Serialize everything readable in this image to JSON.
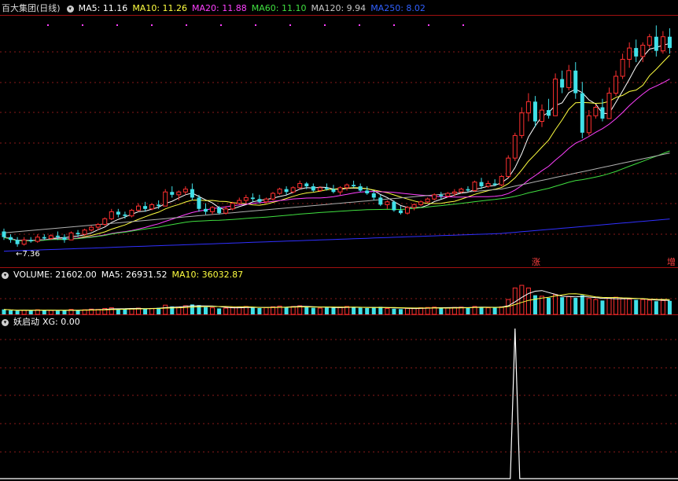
{
  "price_header": {
    "title": "百大集团(日线)",
    "ma5": "MA5: 11.16",
    "ma10": "MA10: 11.26",
    "ma20": "MA20: 11.88",
    "ma60": "MA60: 11.10",
    "ma120": "MA120: 9.94",
    "ma250": "MA250: 8.02"
  },
  "volume_header": {
    "volume": "VOLUME: 21602.00",
    "ma5": "MA5: 26931.52",
    "ma10": "MA10: 36032.87"
  },
  "indicator_header": {
    "name": "妖启动",
    "xg": "XG: 0.00"
  },
  "annotations": {
    "low_price": "7.36",
    "zhang_marker": "涨",
    "zeng_marker": "增"
  },
  "colors": {
    "up": "#ff3030",
    "down": "#40e0e8",
    "ma5": "#ffffff",
    "ma10": "#ffff40",
    "ma20": "#ff40ff",
    "ma60": "#40e040",
    "ma120": "#b0b0b0",
    "ma250": "#3030ff",
    "grid": "#8a1a1a"
  },
  "chart_data": [
    {
      "type": "candlestick",
      "title": "百大集团(日线)",
      "ylim": [
        6.8,
        15.6
      ],
      "low_label": 7.36,
      "ohlc": [
        [
          7.9,
          8.0,
          7.6,
          7.7
        ],
        [
          7.7,
          7.8,
          7.5,
          7.6
        ],
        [
          7.6,
          7.7,
          7.36,
          7.45
        ],
        [
          7.45,
          7.7,
          7.4,
          7.6
        ],
        [
          7.6,
          7.7,
          7.5,
          7.55
        ],
        [
          7.55,
          7.8,
          7.5,
          7.7
        ],
        [
          7.7,
          7.8,
          7.6,
          7.65
        ],
        [
          7.65,
          7.8,
          7.6,
          7.75
        ],
        [
          7.75,
          7.9,
          7.6,
          7.7
        ],
        [
          7.7,
          7.8,
          7.5,
          7.6
        ],
        [
          7.6,
          7.9,
          7.6,
          7.85
        ],
        [
          7.85,
          7.95,
          7.7,
          7.8
        ],
        [
          7.8,
          8.0,
          7.75,
          7.95
        ],
        [
          7.95,
          8.1,
          7.9,
          8.05
        ],
        [
          8.05,
          8.2,
          7.95,
          8.15
        ],
        [
          8.15,
          8.4,
          8.1,
          8.35
        ],
        [
          8.35,
          8.7,
          8.3,
          8.6
        ],
        [
          8.6,
          8.7,
          8.4,
          8.5
        ],
        [
          8.5,
          8.6,
          8.35,
          8.45
        ],
        [
          8.45,
          8.7,
          8.4,
          8.65
        ],
        [
          8.65,
          8.9,
          8.6,
          8.8
        ],
        [
          8.8,
          8.95,
          8.6,
          8.7
        ],
        [
          8.7,
          8.9,
          8.65,
          8.85
        ],
        [
          8.85,
          9.0,
          8.7,
          8.8
        ],
        [
          8.8,
          9.4,
          8.8,
          9.3
        ],
        [
          9.3,
          9.5,
          9.1,
          9.2
        ],
        [
          9.2,
          9.35,
          9.0,
          9.3
        ],
        [
          9.3,
          9.5,
          9.2,
          9.4
        ],
        [
          9.4,
          9.6,
          9.0,
          9.1
        ],
        [
          9.1,
          9.2,
          8.6,
          8.7
        ],
        [
          8.7,
          8.9,
          8.5,
          8.6
        ],
        [
          8.6,
          8.8,
          8.5,
          8.75
        ],
        [
          8.75,
          8.8,
          8.5,
          8.55
        ],
        [
          8.55,
          8.8,
          8.5,
          8.7
        ],
        [
          8.7,
          8.95,
          8.65,
          8.9
        ],
        [
          8.9,
          9.1,
          8.85,
          9.0
        ],
        [
          9.0,
          9.2,
          8.9,
          9.1
        ],
        [
          9.1,
          9.25,
          8.95,
          9.05
        ],
        [
          9.05,
          9.2,
          8.9,
          8.95
        ],
        [
          8.95,
          9.1,
          8.9,
          9.05
        ],
        [
          9.05,
          9.3,
          9.0,
          9.25
        ],
        [
          9.25,
          9.45,
          9.2,
          9.4
        ],
        [
          9.4,
          9.5,
          9.2,
          9.3
        ],
        [
          9.3,
          9.5,
          9.25,
          9.45
        ],
        [
          9.45,
          9.7,
          9.4,
          9.6
        ],
        [
          9.6,
          9.65,
          9.4,
          9.5
        ],
        [
          9.5,
          9.6,
          9.3,
          9.35
        ],
        [
          9.35,
          9.5,
          9.3,
          9.45
        ],
        [
          9.45,
          9.6,
          9.35,
          9.4
        ],
        [
          9.4,
          9.55,
          9.25,
          9.3
        ],
        [
          9.3,
          9.5,
          9.2,
          9.45
        ],
        [
          9.45,
          9.6,
          9.35,
          9.55
        ],
        [
          9.55,
          9.7,
          9.45,
          9.5
        ],
        [
          9.5,
          9.6,
          9.3,
          9.35
        ],
        [
          9.35,
          9.5,
          9.2,
          9.25
        ],
        [
          9.25,
          9.35,
          9.0,
          9.1
        ],
        [
          9.1,
          9.2,
          8.8,
          8.85
        ],
        [
          8.85,
          9.0,
          8.7,
          8.95
        ],
        [
          8.95,
          9.0,
          8.6,
          8.65
        ],
        [
          8.65,
          8.8,
          8.5,
          8.55
        ],
        [
          8.55,
          8.8,
          8.5,
          8.75
        ],
        [
          8.75,
          8.9,
          8.65,
          8.85
        ],
        [
          8.85,
          9.0,
          8.8,
          8.95
        ],
        [
          8.95,
          9.1,
          8.9,
          9.05
        ],
        [
          9.05,
          9.25,
          9.0,
          9.2
        ],
        [
          9.2,
          9.3,
          9.05,
          9.15
        ],
        [
          9.15,
          9.3,
          9.1,
          9.25
        ],
        [
          9.25,
          9.4,
          9.15,
          9.3
        ],
        [
          9.3,
          9.45,
          9.25,
          9.4
        ],
        [
          9.4,
          9.5,
          9.3,
          9.35
        ],
        [
          9.35,
          9.7,
          9.3,
          9.65
        ],
        [
          9.65,
          9.8,
          9.4,
          9.5
        ],
        [
          9.5,
          9.7,
          9.45,
          9.6
        ],
        [
          9.6,
          9.75,
          9.5,
          9.55
        ],
        [
          9.55,
          9.9,
          9.5,
          9.85
        ],
        [
          9.85,
          10.6,
          9.8,
          10.5
        ],
        [
          10.5,
          11.4,
          10.4,
          11.3
        ],
        [
          11.3,
          12.3,
          11.2,
          12.1
        ],
        [
          12.1,
          12.8,
          11.8,
          12.5
        ],
        [
          12.5,
          12.7,
          11.6,
          11.8
        ],
        [
          11.8,
          12.4,
          11.6,
          12.2
        ],
        [
          12.2,
          12.6,
          11.9,
          12.0
        ],
        [
          12.0,
          13.5,
          12.0,
          13.3
        ],
        [
          13.3,
          13.6,
          12.8,
          13.0
        ],
        [
          13.0,
          13.8,
          12.9,
          13.6
        ],
        [
          13.6,
          13.9,
          12.6,
          12.8
        ],
        [
          12.8,
          13.2,
          11.2,
          11.4
        ],
        [
          11.4,
          12.2,
          11.3,
          12.0
        ],
        [
          12.0,
          12.4,
          11.9,
          12.3
        ],
        [
          12.3,
          12.6,
          11.8,
          11.9
        ],
        [
          11.9,
          13.0,
          11.9,
          12.8
        ],
        [
          12.8,
          13.6,
          12.7,
          13.4
        ],
        [
          13.4,
          14.2,
          13.3,
          14.0
        ],
        [
          14.0,
          14.6,
          13.7,
          14.4
        ],
        [
          14.4,
          14.7,
          13.9,
          14.1
        ],
        [
          14.1,
          14.6,
          13.9,
          14.5
        ],
        [
          14.5,
          14.9,
          14.4,
          14.8
        ],
        [
          14.8,
          15.2,
          14.1,
          14.3
        ],
        [
          14.3,
          15.0,
          14.2,
          14.8
        ],
        [
          14.8,
          15.1,
          14.2,
          14.4
        ]
      ]
    },
    {
      "type": "bar",
      "title": "VOLUME",
      "ylim": [
        0,
        100000
      ],
      "values": [
        15000,
        12000,
        11000,
        13000,
        12000,
        14000,
        13000,
        12000,
        11000,
        13000,
        15000,
        12000,
        14000,
        16000,
        15000,
        18000,
        20000,
        16000,
        17000,
        18000,
        19000,
        17000,
        18000,
        20000,
        28000,
        24000,
        22000,
        26000,
        30000,
        28000,
        22000,
        20000,
        18000,
        19000,
        21000,
        22000,
        24000,
        20000,
        19000,
        21000,
        23000,
        25000,
        22000,
        24000,
        26000,
        23000,
        20000,
        19000,
        21000,
        20000,
        22000,
        24000,
        21000,
        20000,
        19000,
        22000,
        23000,
        18000,
        17000,
        16000,
        18000,
        19000,
        20000,
        21000,
        22000,
        19000,
        20000,
        21000,
        22000,
        20000,
        24000,
        22000,
        20000,
        21000,
        23000,
        45000,
        80000,
        88000,
        80000,
        58000,
        55000,
        50000,
        60000,
        52000,
        54000,
        50000,
        58000,
        48000,
        45000,
        42000,
        50000,
        52000,
        48000,
        46000,
        44000,
        45000,
        43000,
        40000,
        42000,
        41000
      ]
    },
    {
      "type": "line",
      "title": "妖启动",
      "ylim": [
        0,
        1
      ],
      "signal_index": 76,
      "signal_value": 1,
      "baseline_value": 0
    }
  ]
}
